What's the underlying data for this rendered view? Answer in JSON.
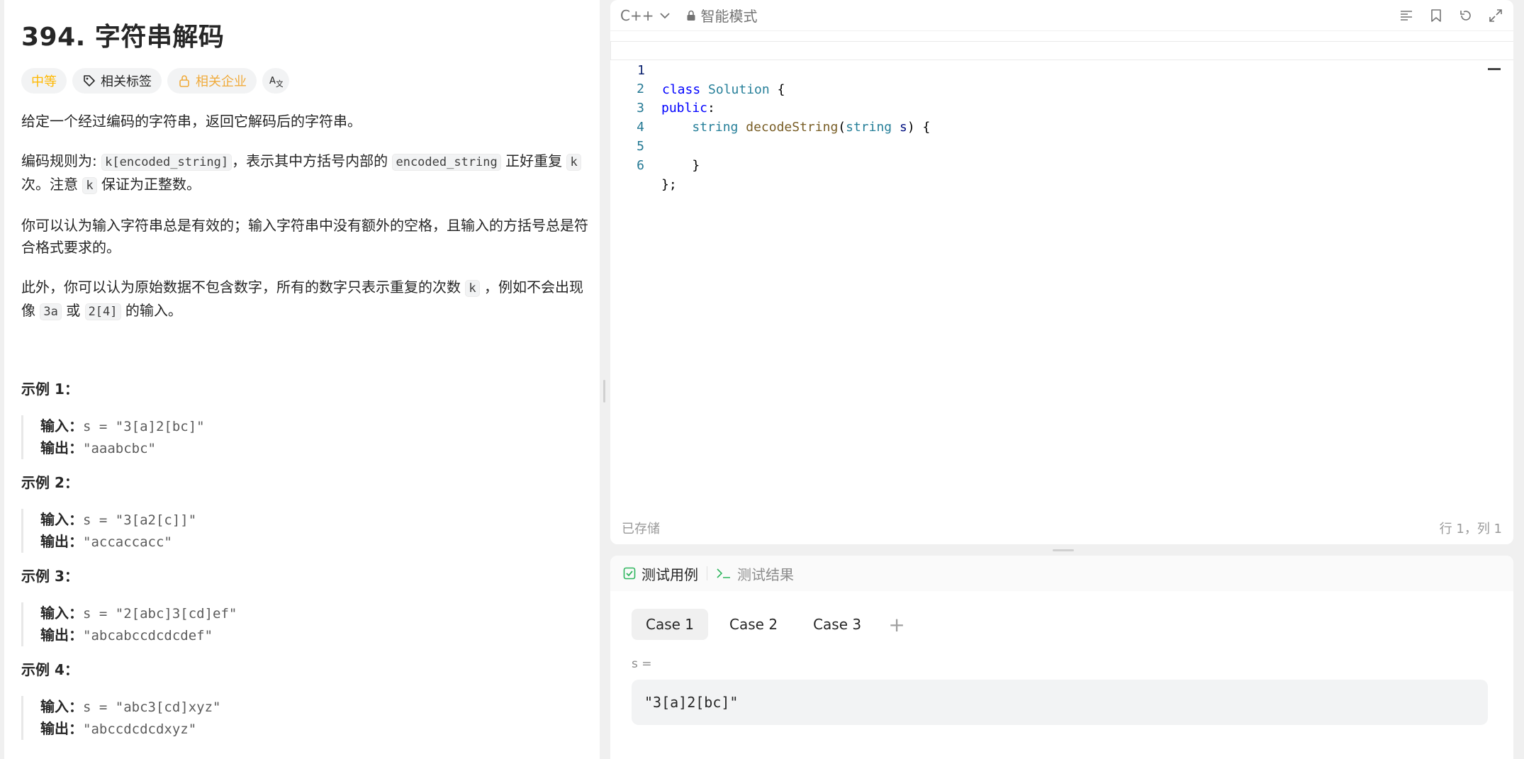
{
  "problem": {
    "title": "394. 字符串解码",
    "tags": {
      "difficulty": "中等",
      "related_tags": "相关标签",
      "related_companies": "相关企业",
      "translate_icon": "translate-icon"
    },
    "desc": {
      "p1": "给定一个经过编码的字符串，返回它解码后的字符串。",
      "p2_a": "编码规则为: ",
      "p2_code1": "k[encoded_string]",
      "p2_b": "，表示其中方括号内部的 ",
      "p2_code2": "encoded_string",
      "p2_c": " 正好重复 ",
      "p2_code3": "k",
      "p2_d": " 次。注意 ",
      "p2_code4": "k",
      "p2_e": " 保证为正整数。",
      "p3": "你可以认为输入字符串总是有效的；输入字符串中没有额外的空格，且输入的方括号总是符合格式要求的。",
      "p4_a": "此外，你可以认为原始数据不包含数字，所有的数字只表示重复的次数 ",
      "p4_code1": "k",
      "p4_b": " ，例如不会出现像 ",
      "p4_code2": "3a",
      "p4_c": " 或 ",
      "p4_code3": "2[4]",
      "p4_d": " 的输入。"
    },
    "examples": [
      {
        "head": "示例 1：",
        "input_label": "输入：",
        "input": "s = \"3[a]2[bc]\"",
        "output_label": "输出：",
        "output": "\"aaabcbc\""
      },
      {
        "head": "示例 2：",
        "input_label": "输入：",
        "input": "s = \"3[a2[c]]\"",
        "output_label": "输出：",
        "output": "\"accaccacc\""
      },
      {
        "head": "示例 3：",
        "input_label": "输入：",
        "input": "s = \"2[abc]3[cd]ef\"",
        "output_label": "输出：",
        "output": "\"abcabccdcdcdef\""
      },
      {
        "head": "示例 4：",
        "input_label": "输入：",
        "input": "s = \"abc3[cd]xyz\"",
        "output_label": "输出：",
        "output": "\"abccdcdcdxyz\""
      }
    ]
  },
  "editor": {
    "language": "C++",
    "mode": "智能模式",
    "line_numbers": [
      "1",
      "2",
      "3",
      "4",
      "5",
      "6"
    ],
    "status_saved": "已存储",
    "cursor_pos": "行 1，列 1"
  },
  "tests": {
    "tab_cases": "测试用例",
    "tab_results": "测试结果",
    "cases": [
      "Case 1",
      "Case 2",
      "Case 3"
    ],
    "add": "+",
    "var_label": "s =",
    "var_value": "\"3[a]2[bc]\""
  },
  "colors": {
    "difficulty": "#ffb800",
    "accent_green": "#2db55d"
  }
}
